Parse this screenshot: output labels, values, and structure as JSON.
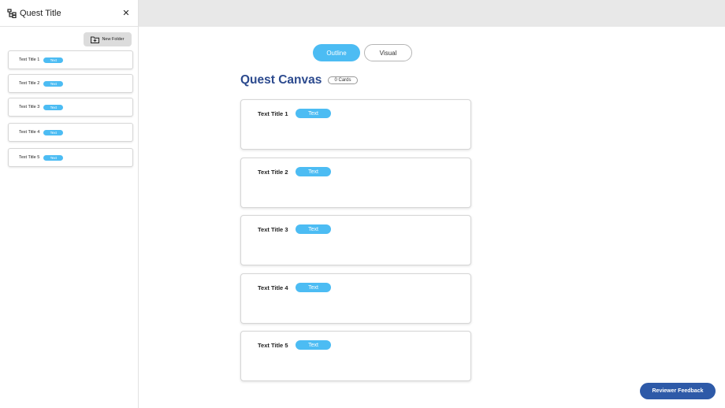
{
  "sidebar": {
    "title": "Quest Title",
    "close_icon": "close-icon",
    "quest_icon": "tree-icon",
    "new_folder_label": "New Folder",
    "items": [
      {
        "title": "Text Title 1",
        "tag": "Text"
      },
      {
        "title": "Text Title 2",
        "tag": "Text"
      },
      {
        "title": "Text Title 3",
        "tag": "Text"
      },
      {
        "title": "Text Title 4",
        "tag": "Text"
      },
      {
        "title": "Text Title 5",
        "tag": "Text"
      }
    ]
  },
  "tabs": {
    "outline": "Outline",
    "visual": "Visual",
    "active": "Outline"
  },
  "canvas": {
    "title": "Quest Canvas",
    "count": "0 Cards",
    "cards": [
      {
        "title": "Text Title 1",
        "tag": "Text"
      },
      {
        "title": "Text Title 2",
        "tag": "Text"
      },
      {
        "title": "Text Title 3",
        "tag": "Text"
      },
      {
        "title": "Text Title 4",
        "tag": "Text"
      },
      {
        "title": "Text Title 5",
        "tag": "Text"
      }
    ]
  },
  "feedback_label": "Reviewer Feedback",
  "colors": {
    "accent": "#4cbcf3",
    "title": "#2c4a8e",
    "feedback": "#2e5aa8",
    "topbar": "#e8e8e8"
  }
}
